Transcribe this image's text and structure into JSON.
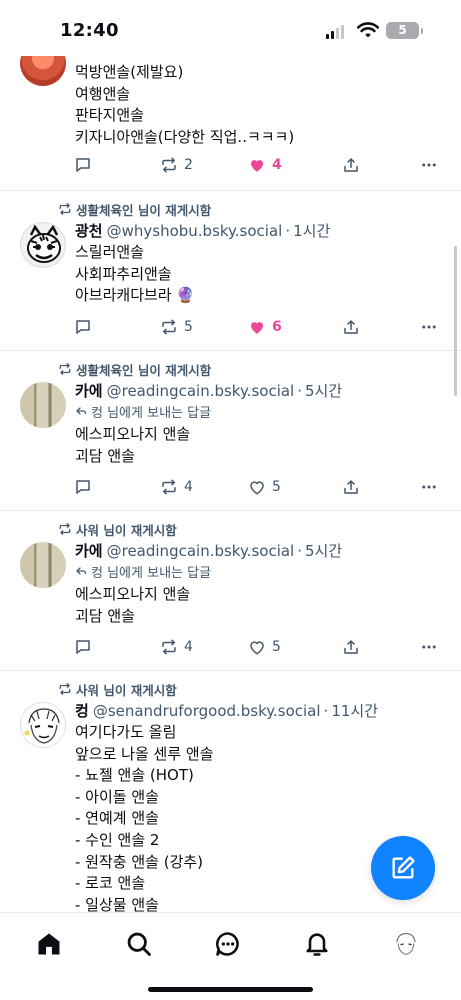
{
  "status_bar": {
    "time": "12:40",
    "battery": "5"
  },
  "posts": [
    {
      "text": "먹방앤솔(제발요)\n여행앤솔\n판타지앤솔\n키자니아앤솔(다양한 직업..ㅋㅋㅋ)",
      "reply_count": "",
      "repost_count": "2",
      "like_count": "4",
      "liked": true
    },
    {
      "repost_by": "생활체육인 님이 재게시함",
      "name": "광천",
      "handle": "@whyshobu.bsky.social",
      "age": "1시간",
      "text": "스릴러앤솔\n사회파추리앤솔\n아브라캐다브라 🔮",
      "reply_count": "",
      "repost_count": "5",
      "like_count": "6",
      "liked": true
    },
    {
      "repost_by": "생활체육인 님이 재게시함",
      "name": "카에",
      "handle": "@readingcain.bsky.social",
      "age": "5시간",
      "reply_to": "컹 님에게 보내는 답글",
      "text": "에스피오나지 앤솔\n괴담 앤솔",
      "reply_count": "",
      "repost_count": "4",
      "like_count": "5",
      "liked": false
    },
    {
      "repost_by": "사워 님이 재게시함",
      "name": "카에",
      "handle": "@readingcain.bsky.social",
      "age": "5시간",
      "reply_to": "컹 님에게 보내는 답글",
      "text": "에스피오나지 앤솔\n괴담 앤솔",
      "reply_count": "",
      "repost_count": "4",
      "like_count": "5",
      "liked": false
    },
    {
      "repost_by": "사워 님이 재게시함",
      "name": "컹",
      "handle": "@senandruforgood.bsky.social",
      "age": "11시간",
      "text": "여기다가도 올림\n앞으로 나올 센루 앤솔\n- 뇨젤 앤솔 (HOT)\n- 아이돌 앤솔\n- 연예계 앤솔\n- 수인 앤솔 2\n- 원작충 앤솔 (강추)\n- 로코 앤솔\n- 일상물 앤솔"
    }
  ],
  "icons": {
    "reply": "comment-bubble-icon",
    "repost": "repost-arrows-icon",
    "like": "heart-icon",
    "share": "share-upload-icon",
    "more": "more-dots-icon",
    "compose": "compose-pencil-icon"
  },
  "tabs": [
    "home",
    "search",
    "chat",
    "notifications",
    "profile"
  ],
  "colors": {
    "accent": "#1083fe",
    "like": "#ec4899",
    "muted": "#42576c"
  }
}
